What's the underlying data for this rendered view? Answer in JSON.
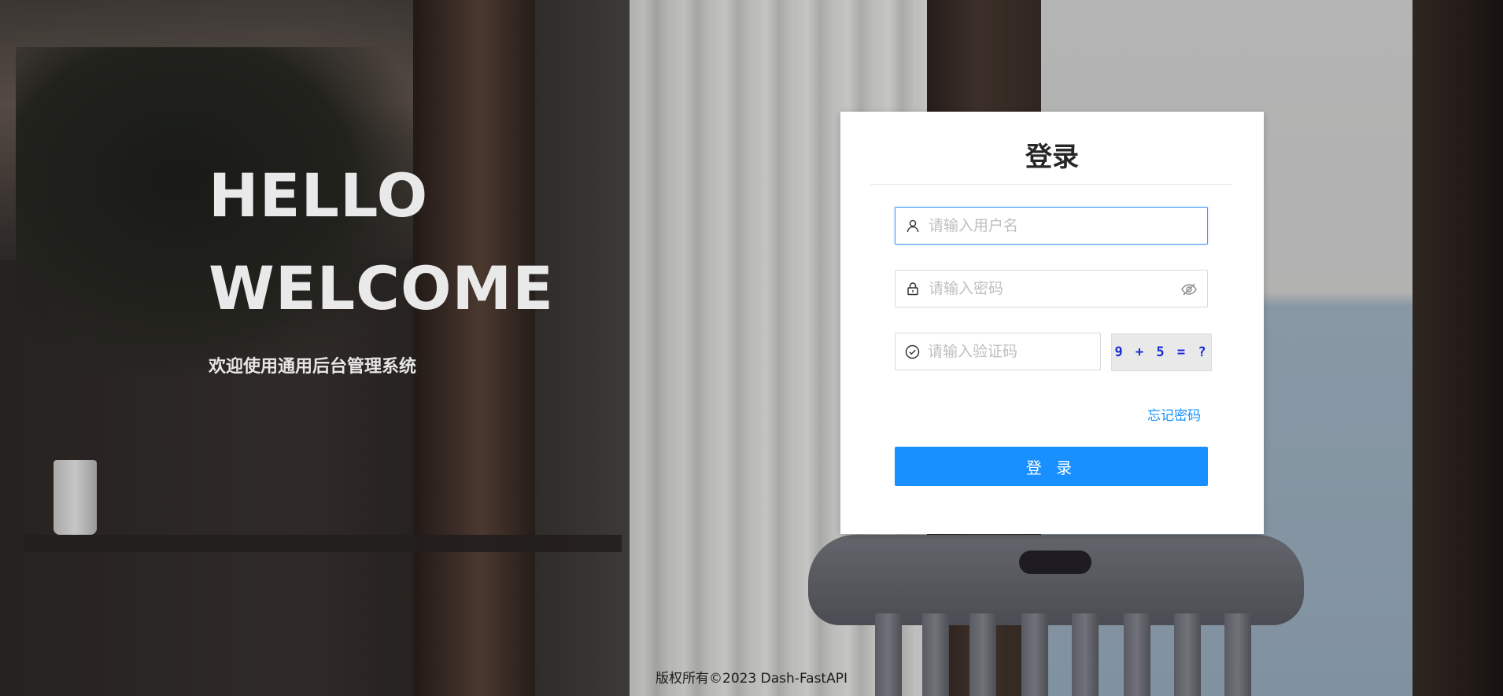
{
  "hero": {
    "line1": "HELLO",
    "line2": "WELCOME",
    "subtitle": "欢迎使用通用后台管理系统"
  },
  "login": {
    "title": "登录",
    "username_placeholder": "请输入用户名",
    "password_placeholder": "请输入密码",
    "captcha_placeholder": "请输入验证码",
    "captcha_text": "9 + 5 = ?",
    "forgot_label": "忘记密码",
    "submit_label": "登 录"
  },
  "footer": {
    "copyright": "版权所有©2023 Dash-FastAPI"
  },
  "colors": {
    "accent": "#1890ff",
    "captcha_text": "#1a2bd6"
  },
  "icons": {
    "username": "user-icon",
    "password": "lock-icon",
    "password_toggle": "eye-invisible-icon",
    "captcha": "check-circle-icon"
  }
}
